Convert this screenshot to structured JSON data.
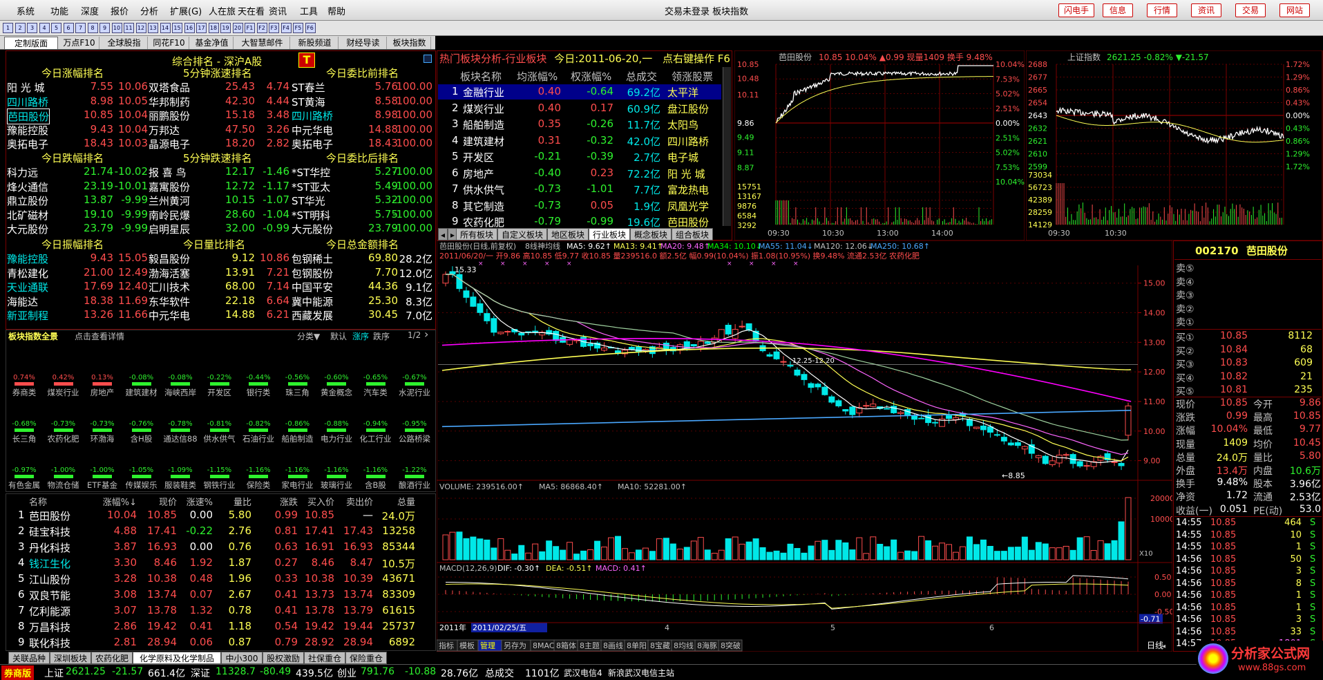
{
  "menu": [
    "系统",
    "功能",
    "深度",
    "报价",
    "分析",
    "扩展(G)",
    "人在旅",
    "天在看",
    "资讯",
    "工具",
    "帮助"
  ],
  "window_title": "交易未登录  板块指数",
  "top_buttons": [
    "闪电手",
    "信息",
    "行情",
    "资讯",
    "交易",
    "网站"
  ],
  "toolbar_icons": [
    "1",
    "2",
    "3",
    "4",
    "5",
    "6",
    "7",
    "8",
    "9",
    "10",
    "11",
    "12",
    "13",
    "14",
    "15",
    "16",
    "17",
    "18",
    "19",
    "20",
    "F1",
    "F2",
    "F3",
    "F4",
    "F5",
    "F6"
  ],
  "tabs": [
    "定制版面",
    "万点F10",
    "全球股指",
    "同花F10",
    "基金净值",
    "大智慧邮件",
    "新股频道",
    "财经导读",
    "板块指数"
  ],
  "ranking": {
    "title": "综合排名 - 深沪A股",
    "sections": [
      {
        "title": "今日涨幅排名",
        "rows": [
          [
            "阳 光 城",
            "7.55",
            "10.06"
          ],
          [
            "四川路桥",
            "8.98",
            "10.05"
          ],
          [
            "芭田股份",
            "10.85",
            "10.04"
          ],
          [
            "豫能控股",
            "9.43",
            "10.04"
          ],
          [
            "奥拓电子",
            "18.43",
            "10.03"
          ]
        ]
      },
      {
        "title": "5分钟涨速排名",
        "rows": [
          [
            "双塔食品",
            "25.43",
            "4.74"
          ],
          [
            "华邦制药",
            "42.30",
            "4.44"
          ],
          [
            "丽鹏股份",
            "15.18",
            "3.48"
          ],
          [
            "万邦达",
            "47.50",
            "3.26"
          ],
          [
            "晶源电子",
            "18.20",
            "2.82"
          ]
        ]
      },
      {
        "title": "今日委比前排名",
        "rows": [
          [
            "ST春兰",
            "5.76",
            "100.00"
          ],
          [
            "ST黄海",
            "8.58",
            "100.00"
          ],
          [
            "四川路桥",
            "8.98",
            "100.00"
          ],
          [
            "中元华电",
            "14.88",
            "100.00"
          ],
          [
            "奥拓电子",
            "18.43",
            "100.00"
          ]
        ]
      },
      {
        "title": "今日跌幅排名",
        "rows": [
          [
            "科力远",
            "21.74",
            "-10.02"
          ],
          [
            "烽火通信",
            "23.19",
            "-10.01"
          ],
          [
            "鼎立股份",
            "13.87",
            "-9.99"
          ],
          [
            "北矿磁材",
            "19.10",
            "-9.99"
          ],
          [
            "大元股份",
            "23.79",
            "-9.99"
          ]
        ]
      },
      {
        "title": "5分钟跌速排名",
        "rows": [
          [
            "报 喜 鸟",
            "12.17",
            "-1.46"
          ],
          [
            "嘉寓股份",
            "12.72",
            "-1.17"
          ],
          [
            "兰州黄河",
            "10.15",
            "-1.07"
          ],
          [
            "南岭民爆",
            "28.60",
            "-1.04"
          ],
          [
            "启明星辰",
            "32.00",
            "-0.99"
          ]
        ]
      },
      {
        "title": "今日委比后排名",
        "rows": [
          [
            "*ST华控",
            "5.27",
            "-100.00"
          ],
          [
            "*ST亚太",
            "5.49",
            "-100.00"
          ],
          [
            "ST华光",
            "5.32",
            "-100.00"
          ],
          [
            "*ST明科",
            "5.75",
            "-100.00"
          ],
          [
            "大元股份",
            "23.79",
            "-100.00"
          ]
        ]
      },
      {
        "title": "今日振幅排名",
        "rows": [
          [
            "豫能控股",
            "9.43",
            "15.05"
          ],
          [
            "青松建化",
            "21.00",
            "12.49"
          ],
          [
            "天业通联",
            "17.69",
            "12.40"
          ],
          [
            "海能达",
            "18.38",
            "11.69"
          ],
          [
            "新亚制程",
            "13.26",
            "11.66"
          ]
        ]
      },
      {
        "title": "今日量比排名",
        "rows": [
          [
            "毅昌股份",
            "9.12",
            "10.86"
          ],
          [
            "渤海活塞",
            "13.91",
            "7.21"
          ],
          [
            "汇川技术",
            "68.00",
            "7.14"
          ],
          [
            "东华软件",
            "22.18",
            "6.64"
          ],
          [
            "中元华电",
            "14.88",
            "6.21"
          ]
        ]
      },
      {
        "title": "今日总金额排名",
        "rows": [
          [
            "包钢稀土",
            "69.80",
            "28.2亿"
          ],
          [
            "包钢股份",
            "7.70",
            "12.0亿"
          ],
          [
            "中国平安",
            "44.36",
            "9.1亿"
          ],
          [
            "冀中能源",
            "25.30",
            "8.3亿"
          ],
          [
            "西藏发展",
            "30.45",
            "7.0亿"
          ]
        ]
      }
    ]
  },
  "board_overview": {
    "title": "板块指数全景",
    "hint": "点击查看详情",
    "controls": [
      "分类▼",
      "默认",
      "涨序",
      "跌序",
      "1/2"
    ],
    "tiles": [
      [
        "0.74%",
        "券商类"
      ],
      [
        "0.42%",
        "煤炭行业"
      ],
      [
        "0.13%",
        "房地产"
      ],
      [
        "-0.08%",
        "建筑建材"
      ],
      [
        "-0.08%",
        "海峡西岸"
      ],
      [
        "-0.22%",
        "开发区"
      ],
      [
        "-0.44%",
        "银行类"
      ],
      [
        "-0.56%",
        "珠三角"
      ],
      [
        "-0.60%",
        "黄金概念"
      ],
      [
        "-0.65%",
        "汽车类"
      ],
      [
        "-0.67%",
        "水泥行业"
      ],
      [
        "-0.68%",
        "长三角"
      ],
      [
        "-0.73%",
        "农药化肥"
      ],
      [
        "-0.73%",
        "环渤海"
      ],
      [
        "-0.76%",
        "含H股"
      ],
      [
        "-0.78%",
        "通达信88"
      ],
      [
        "-0.81%",
        "供水供气"
      ],
      [
        "-0.82%",
        "石油行业"
      ],
      [
        "-0.86%",
        "船舶制造"
      ],
      [
        "-0.88%",
        "电力行业"
      ],
      [
        "-0.94%",
        "化工行业"
      ],
      [
        "-0.95%",
        "公路桥梁"
      ],
      [
        "-0.97%",
        "有色金属"
      ],
      [
        "-1.00%",
        "物流仓储"
      ],
      [
        "-1.00%",
        "ETF基金"
      ],
      [
        "-1.05%",
        "传媒娱乐"
      ],
      [
        "-1.09%",
        "服装鞋类"
      ],
      [
        "-1.15%",
        "钢铁行业"
      ],
      [
        "-1.16%",
        "保险类"
      ],
      [
        "-1.16%",
        "家电行业"
      ],
      [
        "-1.16%",
        "玻璃行业"
      ],
      [
        "-1.16%",
        "含B股"
      ],
      [
        "-1.22%",
        "酿酒行业"
      ]
    ]
  },
  "stock_table": {
    "headers": [
      "名称",
      "涨幅%↓",
      "现价",
      "涨速%",
      "量比",
      "涨跌",
      "买入价",
      "卖出价",
      "总量"
    ],
    "rows": [
      [
        "1",
        "芭田股份",
        "10.04",
        "10.85",
        "0.00",
        "5.80",
        "0.99",
        "10.85",
        "—",
        "24.0万"
      ],
      [
        "2",
        "硅宝科技",
        "4.88",
        "17.41",
        "-0.22",
        "2.76",
        "0.81",
        "17.41",
        "17.43",
        "13258"
      ],
      [
        "3",
        "丹化科技",
        "3.87",
        "16.93",
        "0.00",
        "0.76",
        "0.63",
        "16.91",
        "16.93",
        "85344"
      ],
      [
        "4",
        "钱江生化",
        "3.30",
        "8.46",
        "1.92",
        "1.87",
        "0.27",
        "8.46",
        "8.47",
        "10.5万"
      ],
      [
        "5",
        "江山股份",
        "3.28",
        "10.38",
        "0.48",
        "1.96",
        "0.33",
        "10.38",
        "10.39",
        "43671"
      ],
      [
        "6",
        "双良节能",
        "3.08",
        "13.74",
        "0.07",
        "2.67",
        "0.41",
        "13.73",
        "13.74",
        "83309"
      ],
      [
        "7",
        "亿利能源",
        "3.07",
        "13.78",
        "1.32",
        "0.78",
        "0.41",
        "13.78",
        "13.79",
        "61615"
      ],
      [
        "8",
        "万昌科技",
        "2.86",
        "19.42",
        "0.41",
        "1.18",
        "0.54",
        "19.42",
        "19.44",
        "25737"
      ],
      [
        "9",
        "联化科技",
        "2.81",
        "28.94",
        "0.06",
        "0.87",
        "0.79",
        "28.92",
        "28.94",
        "6892"
      ]
    ],
    "bottom_tabs": [
      "关联品种",
      "深圳板块",
      "农药化肥",
      "化学原料及化学制品",
      "中小300",
      "股权激励",
      "社保重仓",
      "保险重仓"
    ]
  },
  "hot_sectors": {
    "title": "热门板块分析-行业板块",
    "today": "今日:2011-06-20,一",
    "hint": "点右键操作 F6",
    "headers": [
      "板块名称",
      "均涨幅%",
      "权涨幅%",
      "总成交",
      "领涨股票"
    ],
    "rows": [
      [
        "1",
        "金融行业",
        "0.40",
        "-0.64",
        "69.2亿",
        "太平洋"
      ],
      [
        "2",
        "煤炭行业",
        "0.40",
        "0.17",
        "60.9亿",
        "盘江股份"
      ],
      [
        "3",
        "船舶制造",
        "0.35",
        "-0.26",
        "11.7亿",
        "太阳鸟"
      ],
      [
        "4",
        "建筑建材",
        "0.31",
        "-0.32",
        "42.0亿",
        "四川路桥"
      ],
      [
        "5",
        "开发区",
        "-0.21",
        "-0.39",
        "2.7亿",
        "电子城"
      ],
      [
        "6",
        "房地产",
        "-0.40",
        "0.23",
        "72.2亿",
        "阳 光 城"
      ],
      [
        "7",
        "供水供气",
        "-0.73",
        "-1.01",
        "7.7亿",
        "富龙热电"
      ],
      [
        "8",
        "其它制造",
        "-0.73",
        "0.05",
        "1.9亿",
        "凤凰光学"
      ],
      [
        "9",
        "农药化肥",
        "-0.79",
        "-0.99",
        "19.6亿",
        "芭田股份"
      ]
    ],
    "tabs": [
      "所有板块",
      "自定义板块",
      "地区板块",
      "行业板块",
      "概念板块",
      "组合板块"
    ]
  },
  "intraday_stock": {
    "name": "芭田股份",
    "info": "10.85  10.04%  ▲0.99  现量1409  换手 9.48%",
    "left_labels": [
      "10.85",
      "10.48",
      "10.11",
      "9.86",
      "9.49",
      "9.11",
      "8.87",
      "15751",
      "13167",
      "9876",
      "6584",
      "3292"
    ],
    "right_labels": [
      "10.04%",
      "7.53%",
      "5.02%",
      "2.51%",
      "0.00%",
      "2.51%",
      "5.02%",
      "7.53%",
      "10.04%"
    ],
    "times": [
      "09:30",
      "10:30",
      "13:00",
      "14:00"
    ]
  },
  "intraday_index": {
    "name": "上证指数",
    "info": "2621.25  -0.82%  ▼-21.57",
    "left_labels": [
      "2688",
      "2677",
      "2665",
      "2654",
      "2643",
      "2632",
      "2621",
      "2610",
      "2599",
      "73034",
      "56723",
      "42389",
      "28259",
      "14129"
    ],
    "right_labels": [
      "1.72%",
      "1.29%",
      "0.86%",
      "0.43%",
      "0.00%",
      "0.43%",
      "0.86%",
      "1.29%",
      "1.72%"
    ],
    "times": [
      "09:30",
      "10:30"
    ]
  },
  "kline": {
    "title": "芭田股份(日线,前复权)",
    "period": "8线神均线",
    "ma_labels": [
      {
        "t": "MA5: 9.62↑",
        "c": "#ffffff"
      },
      {
        "t": "MA13: 9.41↑",
        "c": "#ffff54"
      },
      {
        "t": "MA20: 9.48↑",
        "c": "#ff66ff"
      },
      {
        "t": "MA34: 10.10↓",
        "c": "#00ff00"
      },
      {
        "t": "MA55: 11.04↓",
        "c": "#4aa8ff"
      },
      {
        "t": "MA120: 12.06↓",
        "c": "#c0c0c0"
      },
      {
        "t": "MA250: 10.68↑",
        "c": "#4aa8ff"
      }
    ],
    "info_line": "2011/06/20/一 开9.86 高10.85 低9.77 收10.85 量239516.0 额2.5亿 幅0.99(10.04%) 振1.08(10.95%) 换9.48% 流通2.53亿 农药化肥",
    "y_labels": [
      "15.00",
      "14.00",
      "13.00",
      "12.00",
      "11.00",
      "10.00",
      "9.00"
    ],
    "annot_high": "15.33",
    "annot_low": "8.85",
    "annot_gap": "12.25-12.20",
    "volume_title": "VOLUME: 239516.00↑",
    "volume_ma5": "MA5: 86868.40↑",
    "volume_ma10": "MA10: 52281.00↑",
    "volume_labels": [
      "20000",
      "10000"
    ],
    "volume_unit": "X10",
    "macd_title": "MACD(12,26,9)",
    "macd_dif": "DIF: -0.30↑",
    "macd_dea": "DEA: -0.51↑",
    "macd_val": "MACD: 0.41↑",
    "macd_labels": [
      "0.50",
      "0.00",
      "-0.50"
    ],
    "macd_current": "-0.71",
    "x_labels": [
      "2011年",
      "2011/02/25/五",
      "4",
      "5",
      "6"
    ],
    "bottom_tabs": [
      "指标",
      "模板",
      "管理",
      "另存为",
      "8MACD",
      "8箱体",
      "8主题",
      "8画线",
      "8单阳",
      "8宝藏",
      "8均线",
      "8海豚",
      "8突破"
    ],
    "period_btn": "日线"
  },
  "quote": {
    "code": "002170",
    "name": "芭田股份",
    "sell": [
      [
        "卖⑤",
        "",
        ""
      ],
      [
        "卖④",
        "",
        ""
      ],
      [
        "卖③",
        "",
        ""
      ],
      [
        "卖②",
        "",
        ""
      ],
      [
        "卖①",
        "",
        ""
      ]
    ],
    "buy": [
      [
        "买①",
        "10.85",
        "8112"
      ],
      [
        "买②",
        "10.84",
        "68"
      ],
      [
        "买③",
        "10.83",
        "609"
      ],
      [
        "买④",
        "10.82",
        "21"
      ],
      [
        "买⑤",
        "10.81",
        "235"
      ]
    ],
    "stats": [
      [
        "现价",
        "10.85",
        "今开",
        "9.86"
      ],
      [
        "涨跌",
        "0.99",
        "最高",
        "10.85"
      ],
      [
        "涨幅",
        "10.04%",
        "最低",
        "9.77"
      ],
      [
        "现量",
        "1409",
        "均价",
        "10.45"
      ],
      [
        "总量",
        "24.0万",
        "量比",
        "5.80"
      ],
      [
        "外盘",
        "13.4万",
        "内盘",
        "10.6万"
      ],
      [
        "换手",
        "9.48%",
        "股本",
        "3.96亿"
      ],
      [
        "净资",
        "1.72",
        "流通",
        "2.53亿"
      ],
      [
        "收益(一)",
        "0.051",
        "PE(动)",
        "53.0"
      ]
    ],
    "ticks": [
      [
        "14:55",
        "10.85",
        "464",
        "S"
      ],
      [
        "14:55",
        "10.85",
        "10",
        "S"
      ],
      [
        "14:55",
        "10.85",
        "1",
        "S"
      ],
      [
        "14:56",
        "10.85",
        "50",
        "S"
      ],
      [
        "14:56",
        "10.85",
        "3",
        "S"
      ],
      [
        "14:56",
        "10.85",
        "8",
        "S"
      ],
      [
        "14:56",
        "10.85",
        "1",
        "S"
      ],
      [
        "14:56",
        "10.85",
        "1",
        "S"
      ],
      [
        "14:56",
        "10.85",
        "3",
        "S"
      ],
      [
        "14:56",
        "10.85",
        "33",
        "S"
      ],
      [
        "14:57",
        "10.85",
        "1801",
        "S"
      ]
    ]
  },
  "statusbar": {
    "brand": "券商版",
    "items": [
      {
        "n": "上证",
        "p": "2621.25",
        "c": "-21.57",
        "a": "661.4亿"
      },
      {
        "n": "深证",
        "p": "11328.7",
        "c": "-80.49",
        "a": "439.5亿"
      },
      {
        "n": "创业",
        "p": "791.76",
        "c": "-10.88",
        "a": "28.76亿"
      }
    ],
    "total_label": "总成交",
    "total": "1101亿",
    "server": "武汉电信4",
    "news": "新浪武汉电信主站"
  },
  "watermark": {
    "name": "分析家公式网",
    "url": "www.88gs.com"
  }
}
